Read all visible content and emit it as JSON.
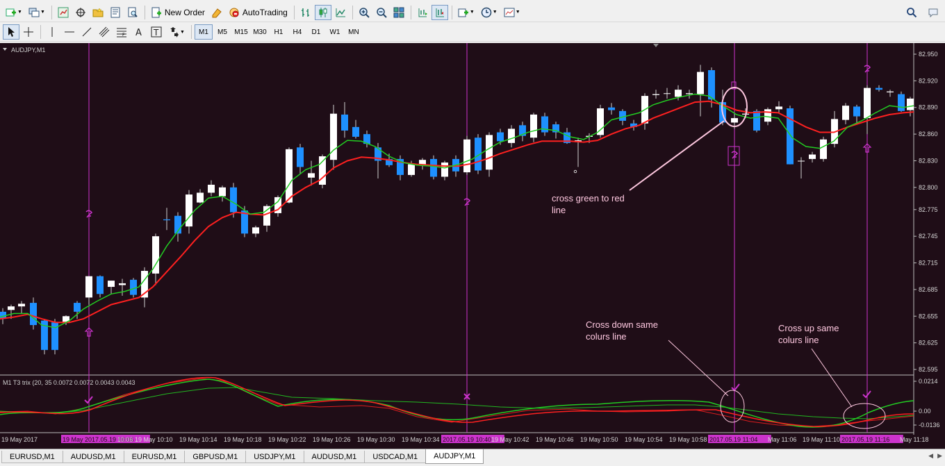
{
  "toolbar_main": {
    "new_order_label": "New Order",
    "autotrading_label": "AutoTrading"
  },
  "timeframes": [
    "M1",
    "M5",
    "M15",
    "M30",
    "H1",
    "H4",
    "D1",
    "W1",
    "MN"
  ],
  "active_timeframe": "M1",
  "chart": {
    "symbol_label": "AUDJPY,M1",
    "indicator_label": "M1 T3 trix (20, 35 0.0072 0.0072 0.0043 0.0043",
    "price_ticks": [
      "82.950",
      "82.920",
      "82.890",
      "82.860",
      "82.830",
      "82.800",
      "82.775",
      "82.745",
      "82.715",
      "82.685",
      "82.655",
      "82.625",
      "82.595"
    ],
    "indicator_ticks": [
      "0.0214",
      "0.00",
      "-0.0136"
    ],
    "time_labels": [
      "19 May 2017",
      "19 May 2017.05.19 10:06",
      "10:06",
      "19 May 10:10",
      "19 May 10:14",
      "19 May 10:18",
      "19 May 10:22",
      "19 May 10:26",
      "19 May 10:30",
      "19 May 10:34",
      "2017.05.19 10:40",
      "19 May 10:42",
      "19 May 10:46",
      "19 May 10:50",
      "19 May 10:54",
      "19 May 10:58",
      "2017.05.19 11:04",
      "May 11:06",
      "19 May 11:10",
      "2017.05.19 11:16",
      "May 11:18"
    ],
    "time_markers": [
      "2017.05.19 10:06",
      "2017.05.19 10:40",
      "2017.05.19 11:04",
      "2017.05.19 11:16"
    ],
    "annotations": {
      "cross_green_red_1": "cross green to red",
      "cross_green_red_2": "line",
      "cross_down_1": "Cross down same",
      "cross_down_2": "colurs line",
      "cross_up_1": "Cross up same",
      "cross_up_2": "colurs line"
    },
    "colors": {
      "background": "#1f0d17",
      "bull_candle": "#ffffff",
      "bear_candle": "#1e90ff",
      "fast_line": "#22cc22",
      "slow_line": "#ff2020",
      "marker": "#cc33cc",
      "annotation": "#ffc8e0"
    }
  },
  "tabs": [
    "EURUSD,M1",
    "AUDUSD,M1",
    "EURUSD,M1",
    "GBPUSD,M1",
    "USDJPY,M1",
    "AUDUSD,M1",
    "USDCAD,M1",
    "AUDJPY,M1"
  ],
  "active_tab": "AUDJPY,M1"
}
